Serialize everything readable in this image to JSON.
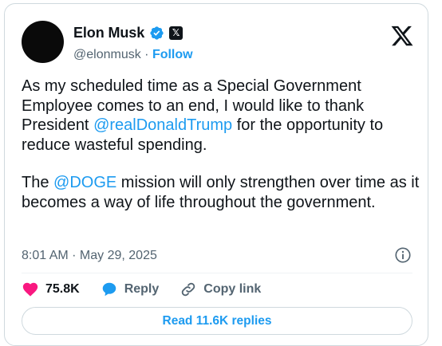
{
  "author": {
    "name": "Elon Musk",
    "handle": "@elonmusk",
    "separator": " · ",
    "follow_label": "Follow",
    "x_badge_glyph": "𝕏"
  },
  "tweet": {
    "p1_a": "As my scheduled time as a Special Government Employee comes to an end, I would like to thank President ",
    "p1_mention": "@realDonaldTrump",
    "p1_b": " for the opportunity to reduce wasteful spending.",
    "p2_a": "The ",
    "p2_mention": "@DOGE",
    "p2_b": " mission will only strengthen over time as it becomes a way of life throughout the government."
  },
  "meta": {
    "timestamp": "8:01 AM · May 29, 2025"
  },
  "actions": {
    "likes": "75.8K",
    "reply_label": "Reply",
    "copy_label": "Copy link"
  },
  "read_replies_label": "Read 11.6K replies",
  "colors": {
    "accent": "#1d9bf0",
    "like": "#f91880",
    "text": "#0f1419",
    "muted": "#536471"
  },
  "icons": [
    "verified-badge-icon",
    "x-badge-icon",
    "x-logo-icon",
    "info-icon",
    "heart-icon",
    "reply-bubble-icon",
    "link-icon"
  ]
}
